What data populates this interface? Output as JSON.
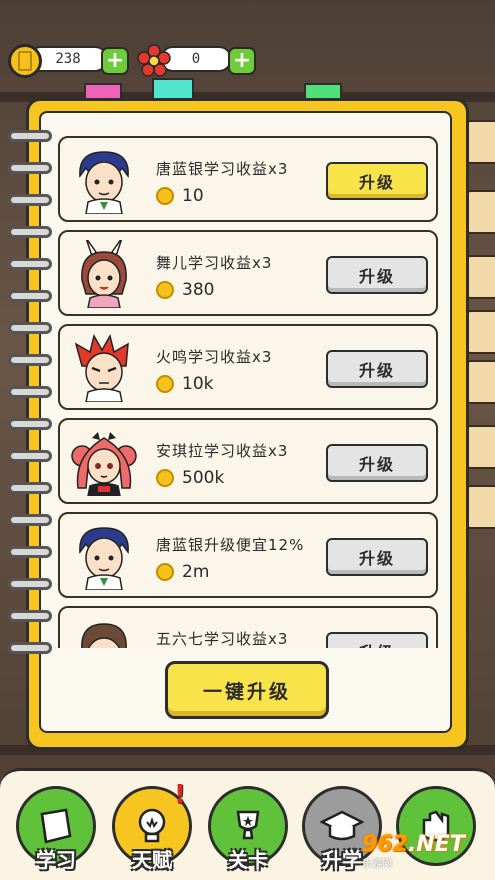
{
  "currency": {
    "coins": "238",
    "flowers": "0"
  },
  "cards": [
    {
      "title": "唐蓝银学习收益x3",
      "cost": "10",
      "button": "升级",
      "active": true
    },
    {
      "title": "舞儿学习收益x3",
      "cost": "380",
      "button": "升级",
      "active": false
    },
    {
      "title": "火鸣学习收益x3",
      "cost": "10k",
      "button": "升级",
      "active": false
    },
    {
      "title": "安琪拉学习收益x3",
      "cost": "500k",
      "button": "升级",
      "active": false
    },
    {
      "title": "唐蓝银升级便宜12%",
      "cost": "2m",
      "button": "升级",
      "active": false
    },
    {
      "title": "五六七学习收益x3",
      "cost": "",
      "button": "升级",
      "active": false
    }
  ],
  "one_click_upgrade": "一键升级",
  "nav": [
    {
      "label": "学习",
      "icon": "book-icon",
      "color": "#5fc23a"
    },
    {
      "label": "天赋",
      "icon": "lightbulb-icon",
      "color": "#f6c51f"
    },
    {
      "label": "关卡",
      "icon": "trophy-icon",
      "color": "#5fc23a"
    },
    {
      "label": "升学",
      "icon": "graduation-cap-icon",
      "color": "#9c9c9c"
    },
    {
      "label": "",
      "icon": "fist-icon",
      "color": "#5fc23a"
    }
  ],
  "nav_alert": "!",
  "watermark": {
    "logo_prefix": "",
    "logo_num": "962",
    "logo_suffix": ".NET",
    "sub": "乐游网"
  }
}
